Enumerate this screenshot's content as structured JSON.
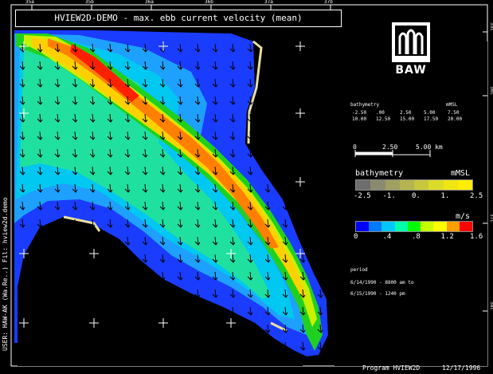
{
  "title": "HVIEW2D-DEMO - max. ebb current velocity (mean)",
  "logo": {
    "text": "BAW"
  },
  "bathy_table": {
    "header": [
      "bathymetry",
      "mMSL"
    ],
    "row1": [
      "-2.50",
      ".00",
      "2.50",
      "5.00",
      "7.50"
    ],
    "row2": [
      "10.00",
      "12.50",
      "15.00",
      "17.50",
      "20.00"
    ]
  },
  "scale_bar": {
    "ticks": [
      "0",
      "2.50",
      "5.00 km"
    ]
  },
  "bathymetry_legend": {
    "label": "bathymetry",
    "unit": "mMSL",
    "ticks": [
      "-2.5",
      "-1.",
      "0.",
      "1.",
      "2.5"
    ],
    "colors": [
      "#6e6e6e",
      "#8a8a6e",
      "#a0a060",
      "#b4b450",
      "#c8c83c",
      "#dcdc28",
      "#f0e614",
      "#ffee00"
    ]
  },
  "velocity_legend": {
    "unit": "m/s",
    "ticks": [
      "0",
      ".4",
      ".8",
      "1.2",
      "1.6"
    ],
    "colors": [
      "#0000ff",
      "#0078ff",
      "#00c8ff",
      "#00ffaa",
      "#00ff00",
      "#c8ff00",
      "#ffff00",
      "#ffa000",
      "#ff0000"
    ]
  },
  "period": {
    "label": "period",
    "lines": [
      "6/14/1990 - 8800 am to",
      "6/15/1990 - 1240 pm"
    ]
  },
  "top_ticks": [
    "35a",
    "35b",
    "36a",
    "36b",
    "37a",
    "37b"
  ],
  "right_ticks": [
    "35c",
    "36c",
    "37c",
    "38c"
  ],
  "vertical_text": "USER: HAW-AK (Wa.Re..) Fil: hview2d.demo",
  "footer": {
    "program": "Program HVIEW2D",
    "date": "12/17/1996"
  }
}
